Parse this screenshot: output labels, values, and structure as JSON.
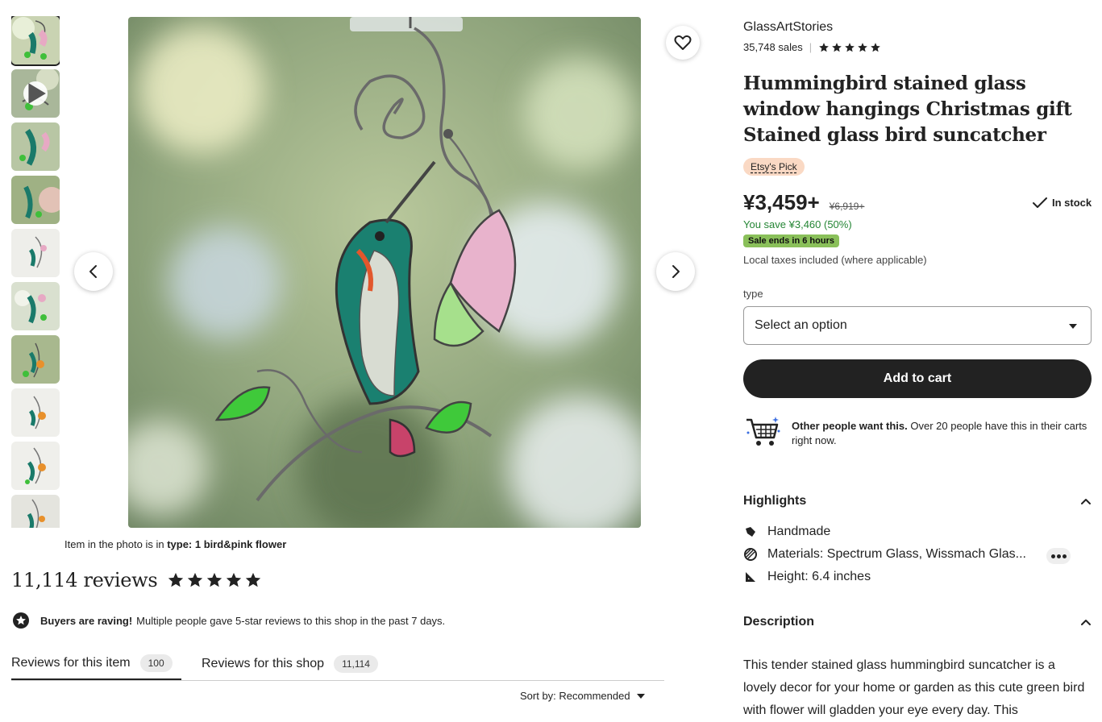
{
  "gallery": {
    "thumbnail_count": 10,
    "active_index": 0,
    "video_thumbnail_index": 1,
    "caption_prefix": "Item in the photo is in ",
    "caption_value": "type: 1 bird&pink flower"
  },
  "shop": {
    "name": "GlassArtStories",
    "sales": "35,748 sales",
    "rating_stars": 5
  },
  "listing": {
    "title": "Hummingbird stained glass window hangings Christmas gift Stained glass bird suncatcher",
    "badge": "Etsy's Pick",
    "price": "¥3,459+",
    "old_price": "¥6,919+",
    "stock": "In stock",
    "savings": "You save ¥3,460 (50%)",
    "sale_badge": "Sale ends in 6 hours",
    "taxes": "Local taxes included (where applicable)",
    "option_label": "type",
    "option_placeholder": "Select an option",
    "add_to_cart": "Add to cart",
    "others_bold": "Other people want this.",
    "others_text": " Over 20 people have this in their carts right now."
  },
  "highlights": {
    "heading": "Highlights",
    "items": [
      {
        "icon": "hand-icon",
        "label": "Handmade"
      },
      {
        "icon": "materials-icon",
        "label": "Materials: Spectrum Glass, Wissmach Glas..."
      },
      {
        "icon": "ruler-icon",
        "label": "Height: 6.4 inches"
      }
    ]
  },
  "description": {
    "heading": "Description",
    "text": "This tender stained glass hummingbird suncatcher is a lovely decor for your home or garden as this cute green bird with flower will gladden your eye every day. This"
  },
  "reviews": {
    "count_label": "11,114 reviews",
    "rating_stars": 5,
    "raving_bold": "Buyers are raving!",
    "raving_text": "Multiple people gave 5-star reviews to this shop in the past 7 days.",
    "tabs": [
      {
        "label": "Reviews for this item",
        "count": "100",
        "active": true
      },
      {
        "label": "Reviews for this shop",
        "count": "11,114",
        "active": false
      }
    ],
    "sort_label": "Sort by: Recommended"
  },
  "colors": {
    "accent": "#222222",
    "savings_green": "#258635",
    "sale_badge_bg": "#8ac05a",
    "pick_badge_bg": "#fad9c4"
  }
}
